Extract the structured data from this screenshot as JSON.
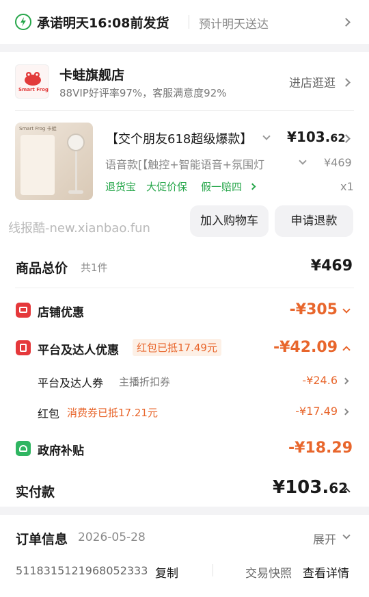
{
  "delivery": {
    "promise": "承诺明天16:08前发货",
    "eta": "预计明天送达"
  },
  "shop": {
    "name": "卡蛙旗舰店",
    "logo_text": "Smart Frog",
    "stats": "88VIP好评率97%，客服满意度92%",
    "visit_label": "进店逛逛"
  },
  "product": {
    "title": "【交个朋友618超级爆款】",
    "price_main": "¥103.",
    "price_cents": "62",
    "variant": "语音款[【触控+智能语音+氛围灯",
    "original_price": "¥469",
    "services": [
      "退货宝",
      "大促价保",
      "假一赔四"
    ],
    "quantity": "x1",
    "thumb_brand": "Smart Frog 卡蛙"
  },
  "actions": {
    "add_to_cart": "加入购物车",
    "refund": "申请退款"
  },
  "watermark": "线报酷-new.xianbao.fun",
  "totals": {
    "goods_total_label": "商品总价",
    "goods_count": "共1件",
    "goods_total": "¥469",
    "shop_discount_label": "店铺优惠",
    "shop_discount": "-¥305",
    "platform_discount_label": "平台及达人优惠",
    "platform_badge": "红包已抵17.49元",
    "platform_discount": "-¥42.09",
    "coupon_label": "平台及达人券",
    "coupon_desc": "主播折扣券",
    "coupon_value": "-¥24.6",
    "redpack_label": "红包",
    "redpack_desc": "消费券已抵17.21元",
    "redpack_value": "-¥17.49",
    "subsidy_label": "政府补贴",
    "subsidy_value": "-¥18.29",
    "paid_label": "实付款",
    "paid_main": "¥103.",
    "paid_cents": "62"
  },
  "order": {
    "title": "订单信息",
    "date": "2026-05-28",
    "expand": "展开",
    "number": "5118315121968052333",
    "copy": "复制",
    "snapshot": "交易快照",
    "details": "查看详情"
  },
  "colors": {
    "accent_orange": "#e8662c",
    "green": "#26a64a",
    "red_icon": "#e5383b"
  }
}
